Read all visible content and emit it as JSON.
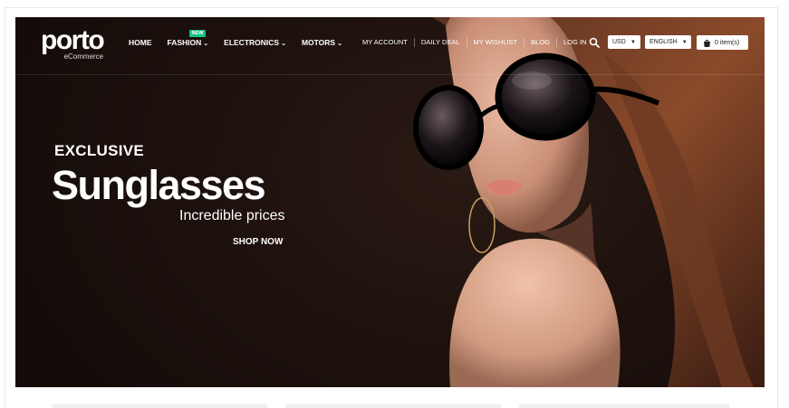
{
  "brand": {
    "name": "porto",
    "tagline": "eCommerce"
  },
  "nav": {
    "items": [
      {
        "label": "HOME",
        "dropdown": false
      },
      {
        "label": "FASHION",
        "dropdown": true,
        "badge": "NEW"
      },
      {
        "label": "ELECTRONICS",
        "dropdown": true
      },
      {
        "label": "MOTORS",
        "dropdown": true
      }
    ]
  },
  "top_links": [
    "MY ACCOUNT",
    "DAILY DEAL",
    "MY WISHLIST",
    "BLOG",
    "LOG IN"
  ],
  "currency": {
    "selected": "USD"
  },
  "language": {
    "selected": "ENGLISH"
  },
  "cart": {
    "label": "0 item(s)"
  },
  "hero": {
    "eyebrow": "EXCLUSIVE",
    "title": "Sunglasses",
    "subtitle": "Incredible prices",
    "cta": "SHOP NOW"
  },
  "colors": {
    "badge": "#0cc485",
    "hero_bg": "#1d110d"
  },
  "icons": {
    "search": "search-icon",
    "cart": "shopping-bag-icon"
  }
}
